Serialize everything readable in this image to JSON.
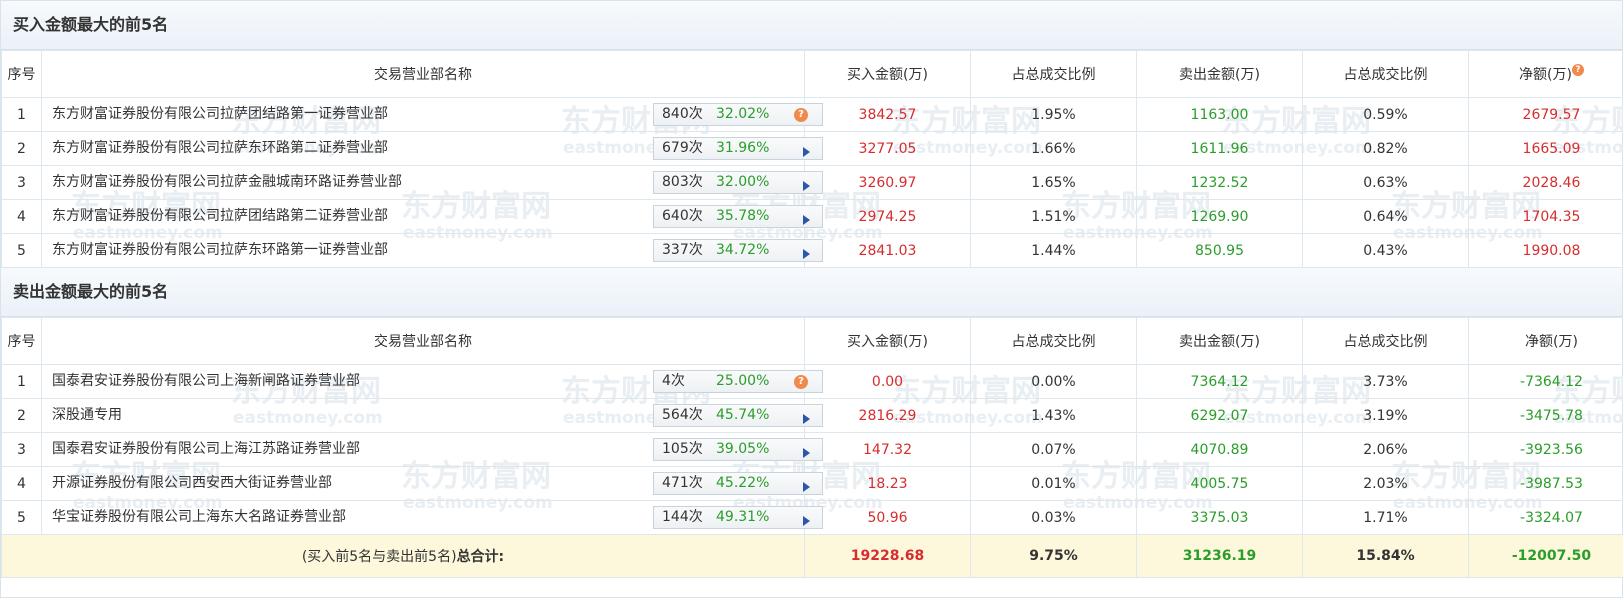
{
  "buy_section": {
    "title": "买入金额最大的前5名",
    "headers": {
      "no": "序号",
      "name": "交易营业部名称",
      "buy": "买入金额(万)",
      "buy_ratio": "占总成交比例",
      "sell": "卖出金额(万)",
      "sell_ratio": "占总成交比例",
      "net": "净额(万)"
    },
    "rows": [
      {
        "no": "1",
        "name": "东方财富证券股份有限公司拉萨团结路第一证券营业部",
        "count": "840次",
        "pct": "32.02%",
        "icon": "question-icon",
        "buy": "3842.57",
        "buy_ratio": "1.95%",
        "sell": "1163.00",
        "sell_ratio": "0.59%",
        "net": "2679.57"
      },
      {
        "no": "2",
        "name": "东方财富证券股份有限公司拉萨东环路第二证券营业部",
        "count": "679次",
        "pct": "31.96%",
        "icon": "arrow-right-icon",
        "buy": "3277.05",
        "buy_ratio": "1.66%",
        "sell": "1611.96",
        "sell_ratio": "0.82%",
        "net": "1665.09"
      },
      {
        "no": "3",
        "name": "东方财富证券股份有限公司拉萨金融城南环路证券营业部",
        "count": "803次",
        "pct": "32.00%",
        "icon": "arrow-right-icon",
        "buy": "3260.97",
        "buy_ratio": "1.65%",
        "sell": "1232.52",
        "sell_ratio": "0.63%",
        "net": "2028.46"
      },
      {
        "no": "4",
        "name": "东方财富证券股份有限公司拉萨团结路第二证券营业部",
        "count": "640次",
        "pct": "35.78%",
        "icon": "arrow-right-icon",
        "buy": "2974.25",
        "buy_ratio": "1.51%",
        "sell": "1269.90",
        "sell_ratio": "0.64%",
        "net": "1704.35"
      },
      {
        "no": "5",
        "name": "东方财富证券股份有限公司拉萨东环路第一证券营业部",
        "count": "337次",
        "pct": "34.72%",
        "icon": "arrow-right-icon",
        "buy": "2841.03",
        "buy_ratio": "1.44%",
        "sell": "850.95",
        "sell_ratio": "0.43%",
        "net": "1990.08"
      }
    ]
  },
  "sell_section": {
    "title": "卖出金额最大的前5名",
    "headers": {
      "no": "序号",
      "name": "交易营业部名称",
      "buy": "买入金额(万)",
      "buy_ratio": "占总成交比例",
      "sell": "卖出金额(万)",
      "sell_ratio": "占总成交比例",
      "net": "净额(万)"
    },
    "rows": [
      {
        "no": "1",
        "name": "国泰君安证券股份有限公司上海新闸路证券营业部",
        "count": "4次",
        "pct": "25.00%",
        "icon": "question-icon",
        "buy": "0.00",
        "buy_ratio": "0.00%",
        "sell": "7364.12",
        "sell_ratio": "3.73%",
        "net": "-7364.12"
      },
      {
        "no": "2",
        "name": "深股通专用",
        "count": "564次",
        "pct": "45.74%",
        "icon": "arrow-right-icon",
        "buy": "2816.29",
        "buy_ratio": "1.43%",
        "sell": "6292.07",
        "sell_ratio": "3.19%",
        "net": "-3475.78"
      },
      {
        "no": "3",
        "name": "国泰君安证券股份有限公司上海江苏路证券营业部",
        "count": "105次",
        "pct": "39.05%",
        "icon": "arrow-right-icon",
        "buy": "147.32",
        "buy_ratio": "0.07%",
        "sell": "4070.89",
        "sell_ratio": "2.06%",
        "net": "-3923.56"
      },
      {
        "no": "4",
        "name": "开源证券股份有限公司西安西大街证券营业部",
        "count": "471次",
        "pct": "45.22%",
        "icon": "arrow-right-icon",
        "buy": "18.23",
        "buy_ratio": "0.01%",
        "sell": "4005.75",
        "sell_ratio": "2.03%",
        "net": "-3987.53"
      },
      {
        "no": "5",
        "name": "华宝证券股份有限公司上海东大名路证券营业部",
        "count": "144次",
        "pct": "49.31%",
        "icon": "arrow-right-icon",
        "buy": "50.96",
        "buy_ratio": "0.03%",
        "sell": "3375.03",
        "sell_ratio": "1.71%",
        "net": "-3324.07"
      }
    ]
  },
  "total": {
    "label_prefix": "(买入前5名与卖出前5名)",
    "label_bold": "总合计:",
    "buy": "19228.68",
    "buy_ratio": "9.75%",
    "sell": "31236.19",
    "sell_ratio": "15.84%",
    "net": "-12007.50"
  },
  "watermark": {
    "cn": "东方财富网",
    "en": "eastmoney.com"
  },
  "colors": {
    "positive": "#d62d2d",
    "negative": "#2a9d2a",
    "total_bg": "#fdf8dc",
    "arrow": "#2c57a8",
    "question": "#f08a4b"
  }
}
